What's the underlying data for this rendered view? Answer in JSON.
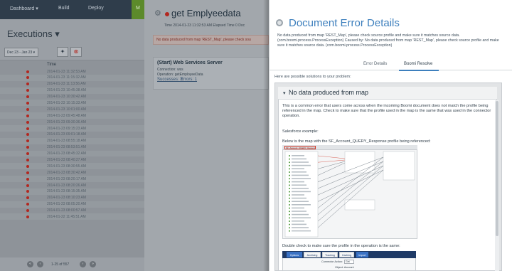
{
  "nav": {
    "items": [
      "Dashboard ▾",
      "Build",
      "Deploy",
      "M"
    ]
  },
  "executions": {
    "title": "Executions ▾",
    "date_range": "Dec 23 - Jan 23 ▾",
    "column_time": "Time",
    "rows": [
      "2014-01-23 11:32:53 AM",
      "2014-01-23 11:15:32 AM",
      "2014-01-23 11:13:56 AM",
      "2014-01-23 10:45:38 AM",
      "2014-01-23 10:30:42 AM",
      "2014-01-23 10:15:33 AM",
      "2014-01-23 10:01:00 AM",
      "2014-01-23 09:45:48 AM",
      "2014-01-23 09:30:36 AM",
      "2014-01-23 09:15:23 AM",
      "2014-01-23 09:01:18 AM",
      "2014-01-23 08:55:18 AM",
      "2014-01-23 08:53:51 AM",
      "2014-01-23 08:45:32 AM",
      "2014-01-23 08:40:27 AM",
      "2014-01-23 08:30:55 AM",
      "2014-01-23 08:30:42 AM",
      "2014-01-23 08:20:17 AM",
      "2014-01-23 08:20:26 AM",
      "2014-01-23 08:15:35 AM",
      "2014-01-23 08:10:23 AM",
      "2014-01-23 08:05:20 AM",
      "2014-01-23 08:00:57 AM",
      "2014-01-22 11:45:51 AM"
    ],
    "pager": "1-25 of 557"
  },
  "detail": {
    "title": "get Emplyeedata",
    "subtitle": "Time 2014-01-23 11:32:53 AM   Elapsed Time 0   Doc",
    "error_banner": "No data produced from map 'REST_Map', please check sou",
    "card_title": "(Start) Web Services Server",
    "connection": "Connection: wss",
    "operation": "Operation: getEmployeeData",
    "link_successes": "Successes: 3",
    "link_errors": "Errors: 1"
  },
  "modal": {
    "title": "Document Error Details",
    "message": "No data produced from map 'REST_Map', please check source profile and make sure it matches source data. (com.boomi.process.ProcessException) Caused by: No data produced from map 'REST_Map', please check source profile and make sure it matches source data. (com.boomi.process.ProcessException)",
    "tab_details": "Error Details",
    "tab_resolve": "Boomi Resolve",
    "solutions_intro": "Here are possible solutions to your problem:",
    "solution_title": "No data produced from map",
    "para1": "This is a common error that users come across when the incoming Boomi document does not match the profile being referenced in the map. Check to make sure that the profile used in the map is the same that was used in the connector operation.",
    "para2": "Salesforce example:",
    "para3": "Below is the map with the SF_Account_QUERY_Response profile being referenced:",
    "map_profile_tag": "SF_Account_QUERY_Response",
    "para4": "Double check to make sure the profile in the operation is the same:",
    "op_tabs": [
      "Options",
      "Archiving",
      "Tracking",
      "Caching",
      "Import"
    ],
    "op_label": "Connector Action:",
    "op_value": "Get",
    "op_label2": "Object:  Account"
  },
  "colors": {
    "accent": "#3d7fbd",
    "error": "#b3271f",
    "nav": "#2f3d4b"
  }
}
